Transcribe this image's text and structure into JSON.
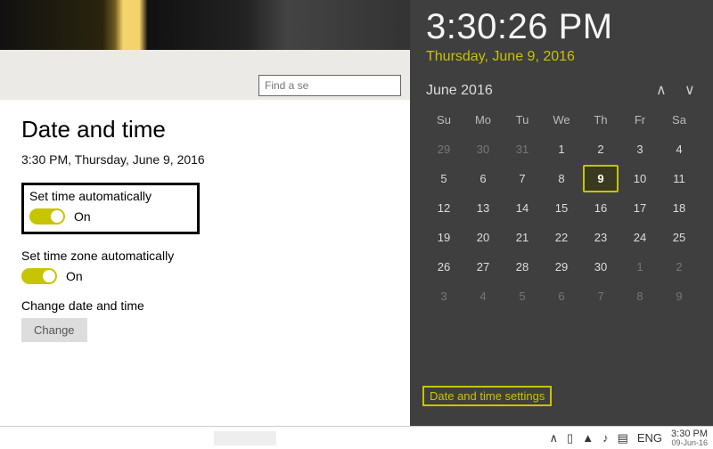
{
  "settings": {
    "search_placeholder": "Find a se",
    "title": "Date and time",
    "current_time_line": "3:30 PM, Thursday, June 9, 2016",
    "set_time_auto": {
      "label": "Set time automatically",
      "state": "On"
    },
    "set_tz_auto": {
      "label": "Set time zone automatically",
      "state": "On"
    },
    "change_dt": {
      "label": "Change date and time",
      "button": "Change"
    }
  },
  "flyout": {
    "time": "3:30:26 PM",
    "date": "Thursday, June 9, 2016",
    "month_label": "June 2016",
    "dow": [
      "Su",
      "Mo",
      "Tu",
      "We",
      "Th",
      "Fr",
      "Sa"
    ],
    "weeks": [
      [
        {
          "n": 29,
          "out": true
        },
        {
          "n": 30,
          "out": true
        },
        {
          "n": 31,
          "out": true
        },
        {
          "n": 1
        },
        {
          "n": 2
        },
        {
          "n": 3
        },
        {
          "n": 4
        }
      ],
      [
        {
          "n": 5
        },
        {
          "n": 6
        },
        {
          "n": 7
        },
        {
          "n": 8
        },
        {
          "n": 9,
          "today": true
        },
        {
          "n": 10
        },
        {
          "n": 11
        }
      ],
      [
        {
          "n": 12
        },
        {
          "n": 13
        },
        {
          "n": 14
        },
        {
          "n": 15
        },
        {
          "n": 16
        },
        {
          "n": 17
        },
        {
          "n": 18
        }
      ],
      [
        {
          "n": 19
        },
        {
          "n": 20
        },
        {
          "n": 21
        },
        {
          "n": 22
        },
        {
          "n": 23
        },
        {
          "n": 24
        },
        {
          "n": 25
        }
      ],
      [
        {
          "n": 26
        },
        {
          "n": 27
        },
        {
          "n": 28
        },
        {
          "n": 29
        },
        {
          "n": 30
        },
        {
          "n": 1,
          "out": true
        },
        {
          "n": 2,
          "out": true
        }
      ],
      [
        {
          "n": 3,
          "out": true
        },
        {
          "n": 4,
          "out": true
        },
        {
          "n": 5,
          "out": true
        },
        {
          "n": 6,
          "out": true
        },
        {
          "n": 7,
          "out": true
        },
        {
          "n": 8,
          "out": true
        },
        {
          "n": 9,
          "out": true
        }
      ]
    ],
    "settings_link": "Date and time settings"
  },
  "taskbar": {
    "lang": "ENG",
    "time": "3:30 PM",
    "date": "09-Jun-16"
  },
  "icons": {
    "chevron_up": "∧",
    "chevron_down": "∨",
    "tray_up": "∧",
    "battery": "▯",
    "wifi": "▲",
    "volume": "♪",
    "action": "▤"
  }
}
